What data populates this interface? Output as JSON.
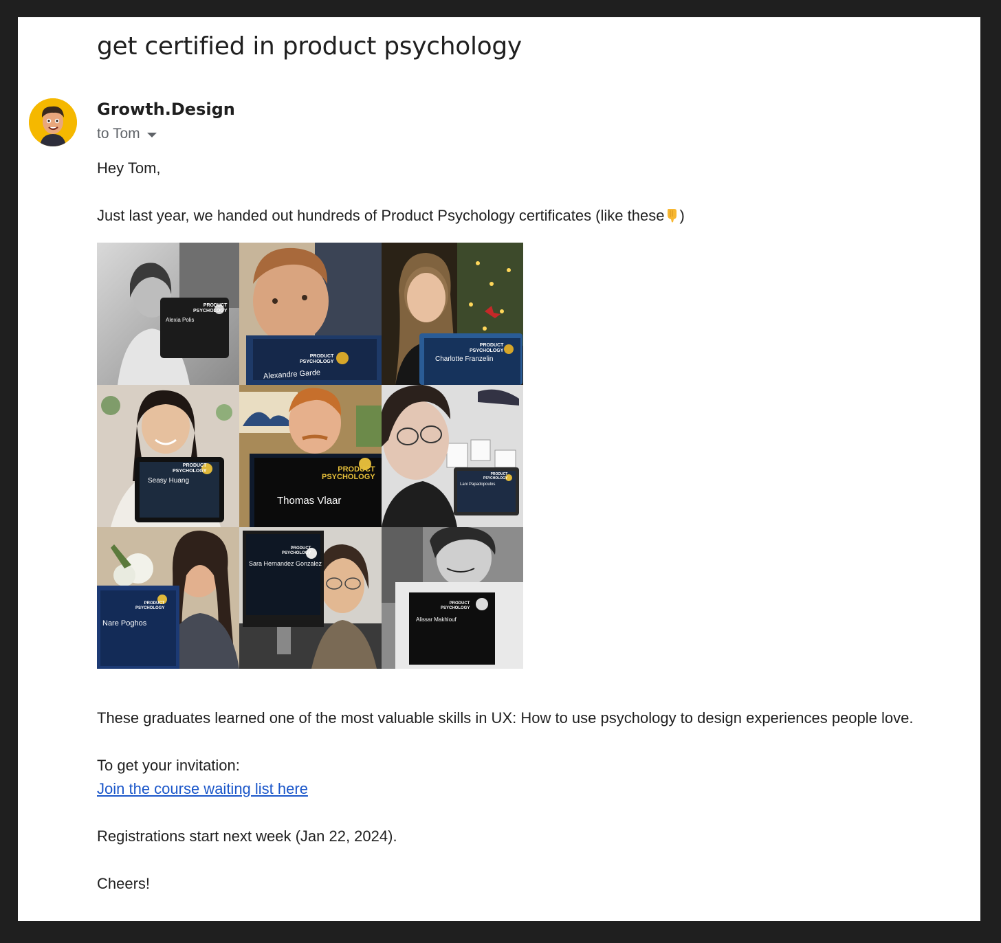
{
  "email": {
    "subject": "get certified in product psychology",
    "sender_name": "Growth.Design",
    "recipient": "to Tom",
    "greeting": "Hey Tom,",
    "intro": "Just last year, we handed out hundreds of Product Psychology certificates (like these",
    "intro_close": ")",
    "graduates_line": "These graduates learned one of the most valuable skills in UX: How to use psychology to design experiences people love.",
    "invite_line": "To get your invitation:",
    "cta_link": "Join the course waiting list here",
    "registration_line": "Registrations start next week (Jan 22, 2024).",
    "signoff": "Cheers!"
  },
  "certificates": {
    "title": "PRODUCT\nPSYCHOLOGY",
    "names": [
      "Alexia Polis",
      "Alexandre Garde",
      "Charlotte Franzelin",
      "Seasy Huang",
      "Thomas Vlaar",
      "Lani Papadopoulos",
      "Nare Poghos",
      "Sara Hernandez Gonzalez",
      "Alissar Makhlouf"
    ]
  },
  "colors": {
    "page_background": "#1f1f1f",
    "card_background": "#ffffff",
    "link": "#1a56c9",
    "avatar_background": "#f5b800"
  },
  "icons": {
    "avatar": "cartoon-face-avatar",
    "recipient_toggle": "caret-down-icon",
    "pointing_hand": "pointing-down-emoji"
  }
}
